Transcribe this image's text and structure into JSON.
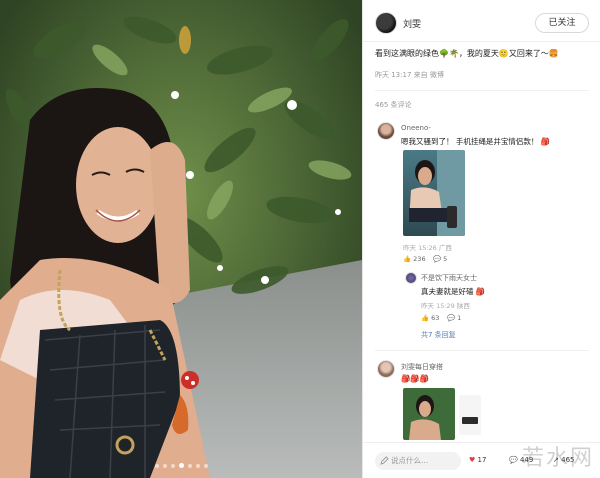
{
  "author": {
    "name": "刘雯",
    "follow_label": "已关注"
  },
  "post": {
    "text": "看到这满眼的绿色🌳🌴，我的夏天🙂又回来了～🍔",
    "time": "昨天 13:17 来自 微博"
  },
  "comments_header": "465 条评论",
  "comments": [
    {
      "name": "Oneeno-",
      "text": "嗯我又骚到了！ 手机挂绳是井宝情侣款！ 🎒",
      "time": "昨天 15:26 广西",
      "likes": "236",
      "replies": "5"
    }
  ],
  "reply": {
    "name": "不是饮下雨天女士",
    "text": "真夫妻就是好磕 🎒",
    "time": "昨天 15:29 陕西",
    "likes": "63",
    "replies": "1",
    "more": "共7 条回复"
  },
  "comment2": {
    "name": "刘雯每日穿搭",
    "text": "🎒🎒🎒"
  },
  "footer": {
    "input_placeholder": "说点什么...",
    "likes": "17",
    "comments": "449",
    "shares": "465"
  },
  "watermark": "若水网",
  "colors": {
    "link": "#5a7db5",
    "like_red": "#e23d3d"
  },
  "gallery": {
    "count": 7,
    "active": 3
  }
}
